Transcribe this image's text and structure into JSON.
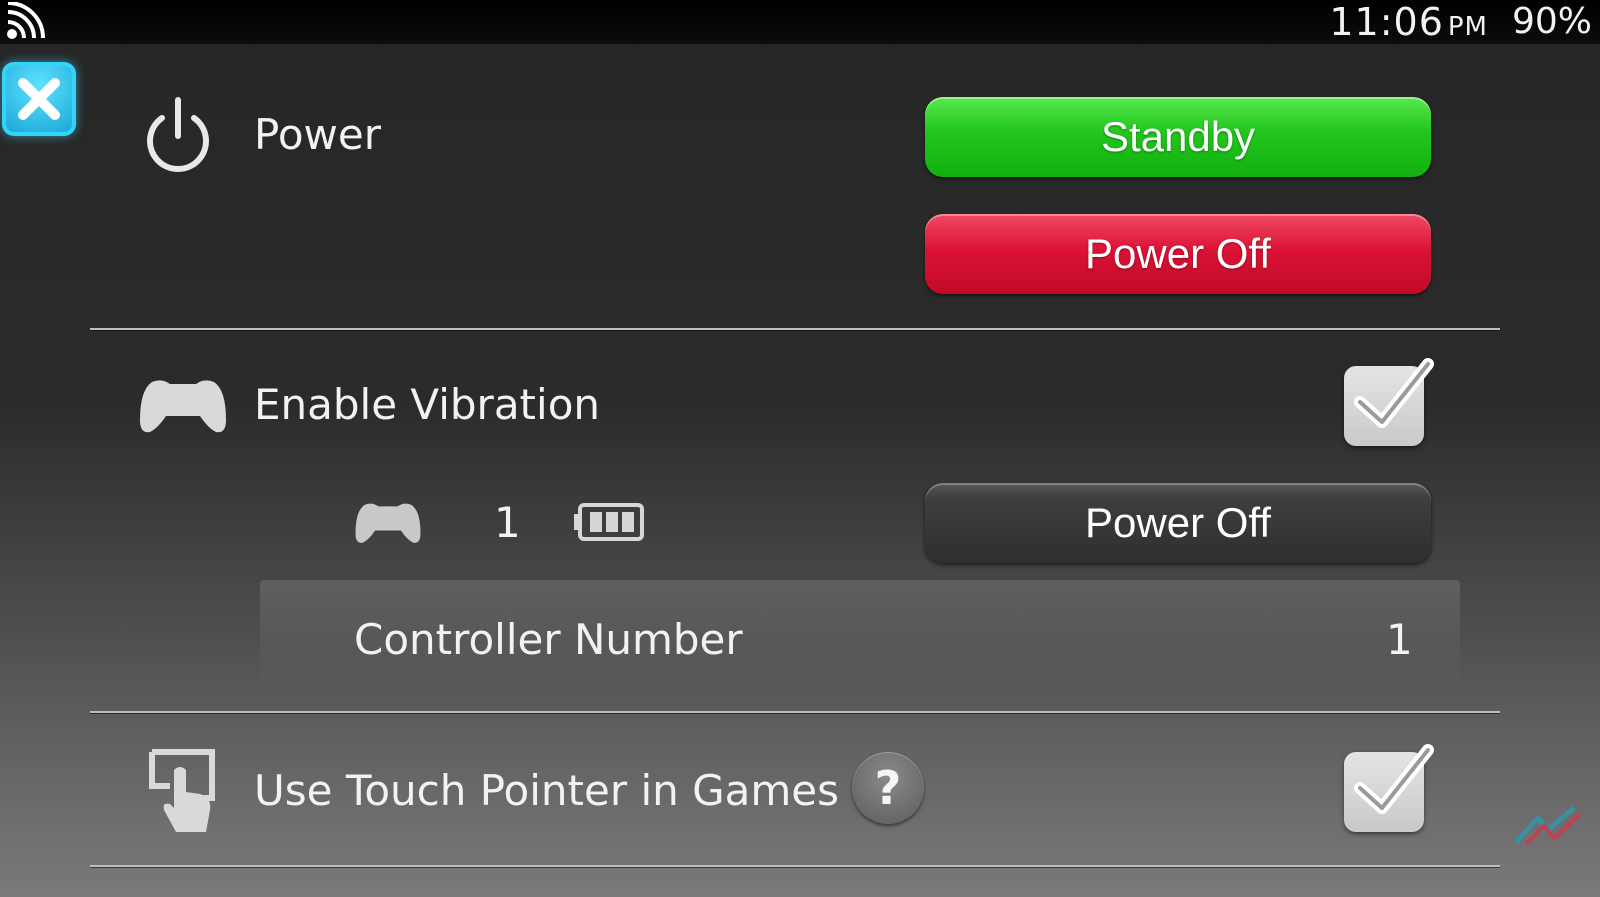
{
  "status_bar": {
    "time": "11:06",
    "ampm": "PM",
    "battery": "90%",
    "signal_icon": "wifi-icon"
  },
  "close_button": {
    "icon": "close-icon"
  },
  "power_section": {
    "label": "Power",
    "icon": "power-icon",
    "standby_label": "Standby",
    "power_off_label": "Power Off"
  },
  "vibration_section": {
    "label": "Enable Vibration",
    "icon": "gamepad-icon",
    "checked": true
  },
  "controller": {
    "icon": "gamepad-icon",
    "number": "1",
    "battery_icon": "battery-icon",
    "battery_level": 0.75,
    "power_off_label": "Power Off"
  },
  "controller_number": {
    "label": "Controller Number",
    "value": "1"
  },
  "touch_pointer_section": {
    "label": "Use Touch Pointer in Games",
    "icon": "touch-pointer-icon",
    "help_label": "?",
    "checked": true
  },
  "colors": {
    "standby": "#1fc21b",
    "power_off": "#d8102f",
    "close_accent": "#35d3f5"
  }
}
